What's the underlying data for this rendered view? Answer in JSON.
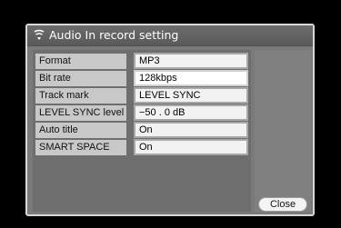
{
  "dialog": {
    "title": "Audio In record setting",
    "title_icon": "audio-in-icon"
  },
  "settings": [
    {
      "label": "Format",
      "value": "MP3"
    },
    {
      "label": "Bit rate",
      "value": "128kbps"
    },
    {
      "label": "Track mark",
      "value": "LEVEL SYNC"
    },
    {
      "label": "LEVEL SYNC level",
      "value": "−50 . 0  dB"
    },
    {
      "label": "Auto title",
      "value": "On"
    },
    {
      "label": "SMART SPACE",
      "value": "On"
    }
  ],
  "buttons": {
    "close_label": "Close"
  }
}
